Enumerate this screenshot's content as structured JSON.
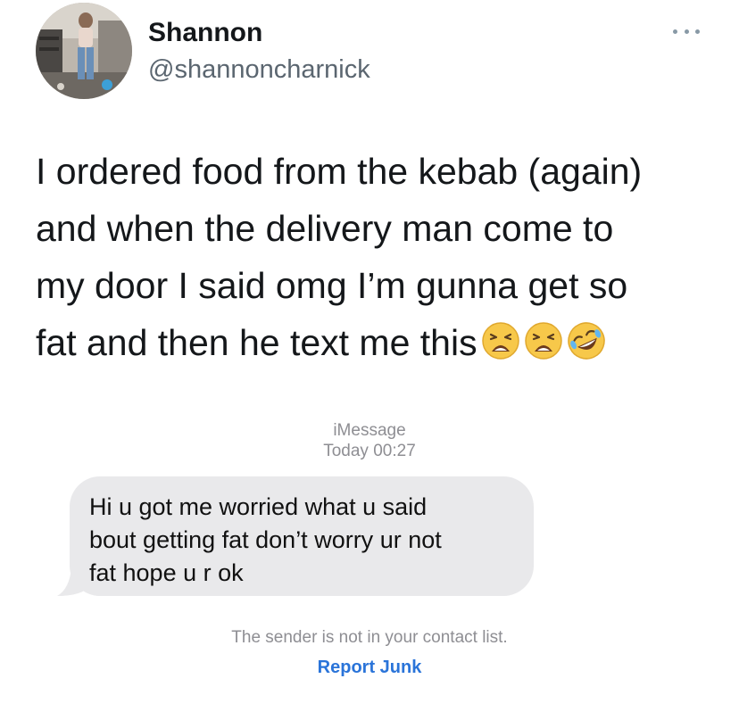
{
  "profile": {
    "display_name": "Shannon",
    "handle": "@shannoncharnick",
    "more_icon": "more-dots-icon"
  },
  "tweet": {
    "lines": [
      "I ordered food from the kebab (again)",
      "and when the delivery man come to",
      "my door I said omg I’m gunna get so",
      "fat and then he text me this"
    ],
    "emojis": [
      "weary-face-emoji",
      "weary-face-emoji",
      "rolling-on-floor-laughing-emoji"
    ]
  },
  "imessage": {
    "service": "iMessage",
    "timestamp": "Today 00:27",
    "bubble_lines": [
      "Hi u got me worried what u said",
      "bout getting fat don’t worry ur not",
      "fat hope u r ok"
    ],
    "sender_note": "The sender is not in your contact list.",
    "report_label": "Report Junk"
  },
  "colors": {
    "text": "#14171a",
    "handle": "#5b6670",
    "bubble": "#e9e9eb",
    "meta": "#8e8e93",
    "link": "#2a74d9"
  }
}
